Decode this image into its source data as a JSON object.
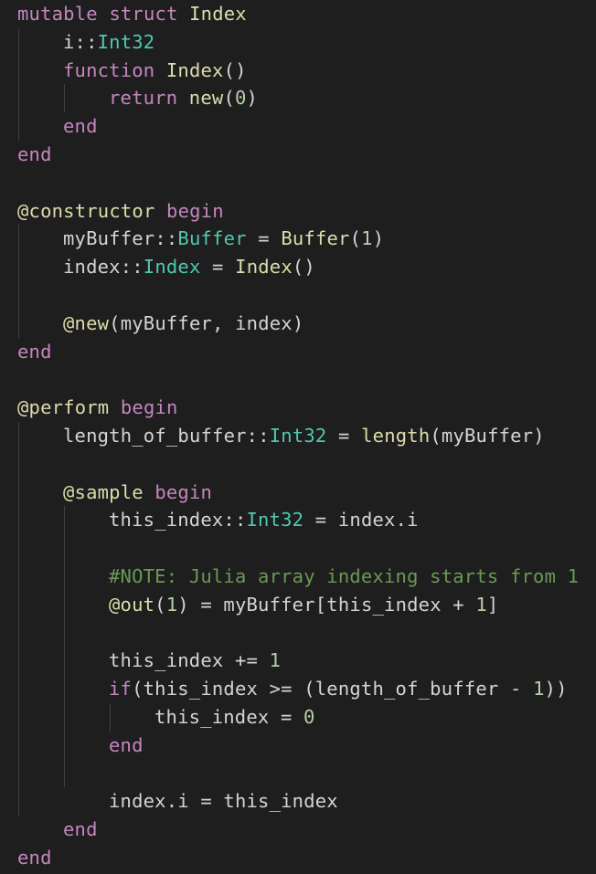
{
  "editor": {
    "lines": [
      {
        "indent": 0,
        "tokens": [
          {
            "t": "mutable struct",
            "k": "kw"
          },
          {
            "t": " Index",
            "k": "fn"
          }
        ]
      },
      {
        "indent": 1,
        "tokens": [
          {
            "t": "i::",
            "k": "id"
          },
          {
            "t": "Int32",
            "k": "ty"
          }
        ]
      },
      {
        "indent": 1,
        "tokens": [
          {
            "t": "function",
            "k": "kw"
          },
          {
            "t": " Index",
            "k": "fn"
          },
          {
            "t": "()",
            "k": "op"
          }
        ]
      },
      {
        "indent": 2,
        "tokens": [
          {
            "t": "return",
            "k": "kw"
          },
          {
            "t": " new",
            "k": "fn"
          },
          {
            "t": "(",
            "k": "op"
          },
          {
            "t": "0",
            "k": "num"
          },
          {
            "t": ")",
            "k": "op"
          }
        ]
      },
      {
        "indent": 1,
        "tokens": [
          {
            "t": "end",
            "k": "kw"
          }
        ]
      },
      {
        "indent": 0,
        "tokens": [
          {
            "t": "end",
            "k": "kw"
          }
        ]
      },
      {
        "indent": 0,
        "tokens": []
      },
      {
        "indent": 0,
        "tokens": [
          {
            "t": "@constructor",
            "k": "mac"
          },
          {
            "t": " begin",
            "k": "kw"
          }
        ]
      },
      {
        "indent": 1,
        "tokens": [
          {
            "t": "myBuffer::",
            "k": "id"
          },
          {
            "t": "Buffer",
            "k": "ty"
          },
          {
            "t": " = ",
            "k": "op"
          },
          {
            "t": "Buffer",
            "k": "fn"
          },
          {
            "t": "(",
            "k": "op"
          },
          {
            "t": "1",
            "k": "num"
          },
          {
            "t": ")",
            "k": "op"
          }
        ]
      },
      {
        "indent": 1,
        "tokens": [
          {
            "t": "index::",
            "k": "id"
          },
          {
            "t": "Index",
            "k": "ty"
          },
          {
            "t": " = ",
            "k": "op"
          },
          {
            "t": "Index",
            "k": "fn"
          },
          {
            "t": "()",
            "k": "op"
          }
        ]
      },
      {
        "indent": 0,
        "tokens": []
      },
      {
        "indent": 1,
        "tokens": [
          {
            "t": "@new",
            "k": "mac"
          },
          {
            "t": "(myBuffer, index)",
            "k": "op"
          }
        ]
      },
      {
        "indent": 0,
        "tokens": [
          {
            "t": "end",
            "k": "kw"
          }
        ]
      },
      {
        "indent": 0,
        "tokens": []
      },
      {
        "indent": 0,
        "tokens": [
          {
            "t": "@perform",
            "k": "mac"
          },
          {
            "t": " begin",
            "k": "kw"
          }
        ]
      },
      {
        "indent": 1,
        "tokens": [
          {
            "t": "length_of_buffer::",
            "k": "id"
          },
          {
            "t": "Int32",
            "k": "ty"
          },
          {
            "t": " = ",
            "k": "op"
          },
          {
            "t": "length",
            "k": "fn"
          },
          {
            "t": "(myBuffer)",
            "k": "op"
          }
        ]
      },
      {
        "indent": 0,
        "tokens": []
      },
      {
        "indent": 1,
        "tokens": [
          {
            "t": "@sample",
            "k": "mac"
          },
          {
            "t": " begin",
            "k": "kw"
          }
        ]
      },
      {
        "indent": 2,
        "tokens": [
          {
            "t": "this_index::",
            "k": "id"
          },
          {
            "t": "Int32",
            "k": "ty"
          },
          {
            "t": " = index.i",
            "k": "op"
          }
        ]
      },
      {
        "indent": 0,
        "tokens": []
      },
      {
        "indent": 2,
        "tokens": [
          {
            "t": "#NOTE: Julia array indexing starts from 1",
            "k": "cm"
          }
        ]
      },
      {
        "indent": 2,
        "tokens": [
          {
            "t": "@out",
            "k": "mac"
          },
          {
            "t": "(",
            "k": "op"
          },
          {
            "t": "1",
            "k": "num"
          },
          {
            "t": ") = myBuffer[this_index + ",
            "k": "op"
          },
          {
            "t": "1",
            "k": "num"
          },
          {
            "t": "]",
            "k": "op"
          }
        ]
      },
      {
        "indent": 0,
        "tokens": []
      },
      {
        "indent": 2,
        "tokens": [
          {
            "t": "this_index += ",
            "k": "op"
          },
          {
            "t": "1",
            "k": "num"
          }
        ]
      },
      {
        "indent": 2,
        "tokens": [
          {
            "t": "if",
            "k": "kw"
          },
          {
            "t": "(this_index >= (length_of_buffer - ",
            "k": "op"
          },
          {
            "t": "1",
            "k": "num"
          },
          {
            "t": "))",
            "k": "op"
          }
        ]
      },
      {
        "indent": 3,
        "tokens": [
          {
            "t": "this_index = ",
            "k": "op"
          },
          {
            "t": "0",
            "k": "num"
          }
        ]
      },
      {
        "indent": 2,
        "tokens": [
          {
            "t": "end",
            "k": "kw"
          }
        ]
      },
      {
        "indent": 0,
        "tokens": []
      },
      {
        "indent": 2,
        "tokens": [
          {
            "t": "index.i = this_index",
            "k": "op"
          }
        ]
      },
      {
        "indent": 1,
        "tokens": [
          {
            "t": "end",
            "k": "kw"
          }
        ]
      },
      {
        "indent": 0,
        "tokens": [
          {
            "t": "end",
            "k": "kw"
          }
        ]
      }
    ]
  }
}
